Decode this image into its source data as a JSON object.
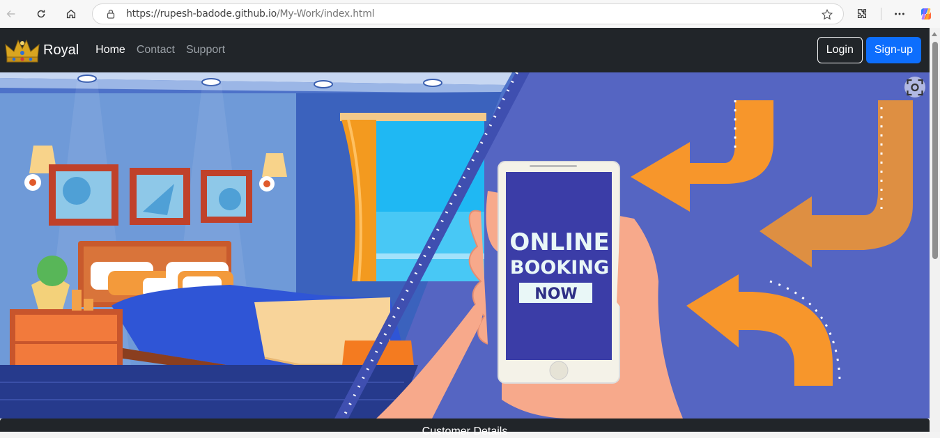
{
  "browser": {
    "url_host": "https://rupesh-badode.github.io",
    "url_path": "/My-Work/index.html"
  },
  "site": {
    "brand": "Royal",
    "nav": [
      {
        "label": "Home",
        "active": true
      },
      {
        "label": "Contact",
        "active": false
      },
      {
        "label": "Support",
        "active": false
      }
    ],
    "login_label": "Login",
    "signup_label": "Sign-up"
  },
  "hero": {
    "line1": "ONLINE",
    "line2": "BOOKING",
    "line3": "NOW"
  },
  "panel": {
    "title": "Customer Details"
  },
  "colors": {
    "navbar": "#212529",
    "signup": "#0d6efd",
    "hero_blue": "#4d63c3",
    "arrow_orange": "#f7962b"
  }
}
